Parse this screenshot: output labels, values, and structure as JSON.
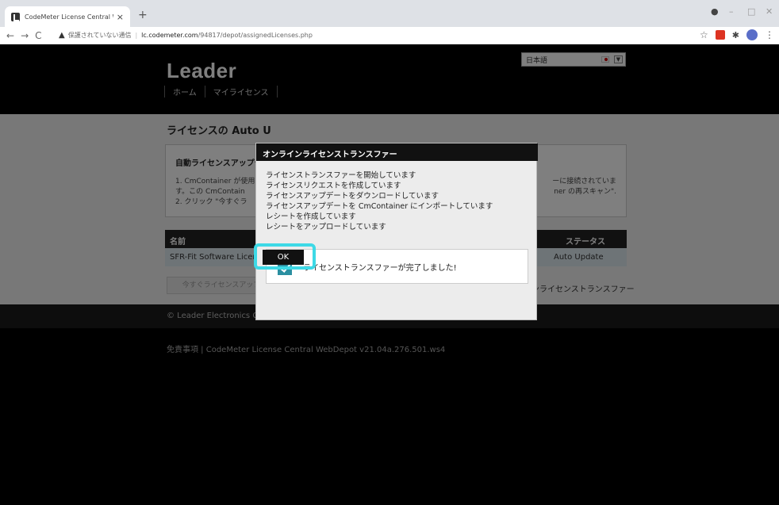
{
  "browser": {
    "tab_title": "CodeMeter License Central WebI",
    "tab_close": "×",
    "new_tab": "+",
    "nav_icons": [
      "back-icon",
      "forward-icon",
      "reload-icon"
    ],
    "security_label": "保護されていない通信",
    "url_host": "lc.codemeter.com",
    "url_path": "/94817/depot/assignedLicenses.php"
  },
  "header": {
    "logo": "Leader",
    "language": "日本語",
    "menu": [
      "ホーム",
      "マイライセンス"
    ]
  },
  "content": {
    "title": "ライセンスの Auto U",
    "infobox_title": "自動ライセンスアップデ",
    "info_left": [
      "1. CmContainer が使用",
      "す。この CmContain",
      "2. クリック \"今すぐラ"
    ],
    "info_right": [
      "ーに接続されていま",
      "ner の再スキャン\"."
    ],
    "table": {
      "col_name": "名前",
      "col_status": "ステータス",
      "row_name": "SFR-Fit Software Licen",
      "row_status": "Auto Update"
    },
    "update_button": "今すぐライセンスアップデートを転送",
    "offline_link": "オフラインライセンストランスファー"
  },
  "footer": {
    "copyright": "© Leader Electronics Corporation",
    "disclaimer": "免責事項 | CodeMeter License Central WebDepot v21.04a.276.501.ws4"
  },
  "dialog": {
    "title": "オンラインライセンストランスファー",
    "steps": [
      "ライセンストランスファーを開始しています",
      "ライセンスリクエストを作成しています",
      "ライセンスアップデートをダウンロードしています",
      "ライセンスアップデートを CmContainer にインポートしています",
      "レシートを作成しています",
      "レシートをアップロードしています"
    ],
    "done_message": "ライセンストランスファーが完了しました!",
    "ok_label": "OK"
  },
  "colors": {
    "highlight": "#3dd9e6",
    "check": "#2b8fa1"
  }
}
